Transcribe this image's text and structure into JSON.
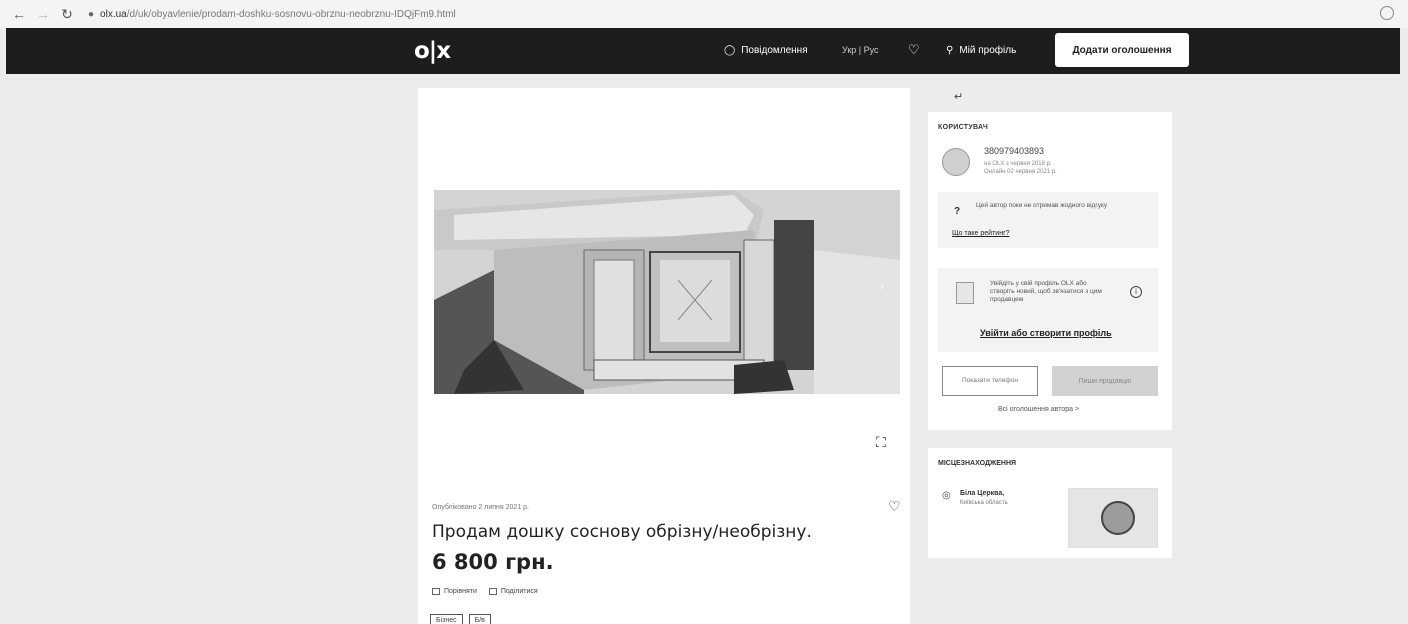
{
  "browser": {
    "back": "←",
    "forward": "→",
    "reload": "↻",
    "lock": "🔒",
    "url_domain": "olx.ua",
    "url_path": "/d/uk/obyavlenie/prodam-doshku-sosnovu-obrznu-neobrznu-IDQjFm9.html"
  },
  "header": {
    "logo": "o|x",
    "messages_label": "Повідомлення",
    "lang_label": "Укр | Рус",
    "favorites_icon": "heart-icon",
    "profile_label": "Мій профіль",
    "post_button": "Додати оголошення"
  },
  "listing": {
    "posted_date": "Опубліковано 2 липня 2021 р.",
    "title": "Продам дошку соснову обрізну/необрізну.",
    "price": "6 800 грн.",
    "tags": [
      "Бізнес",
      "Б/в"
    ]
  },
  "user": {
    "section_label": "КОРИСТУВАЧ",
    "name": "380979403893",
    "sub1": "на OLX з червня 2018 р.",
    "sub2": "Онлайн 02 червня 2021 р.",
    "warn_text": "Цей автор поки не отримав жодного відгуку",
    "warn_link": "Що таке рейтинг?",
    "login_text": "Увійдіть у свій профіль OLX або створіть новий, щоб зв'язатися з цим продавцем",
    "login_link": "Увійти або створити профіль",
    "show_phone": "Показати телефон",
    "write_message": "Пиши продавцю",
    "more_link": "Всі оголошення автора >"
  },
  "location": {
    "section_label": "МІСЦЕЗНАХОДЖЕННЯ",
    "city": "Біла Церква,",
    "region": "Київська область"
  }
}
